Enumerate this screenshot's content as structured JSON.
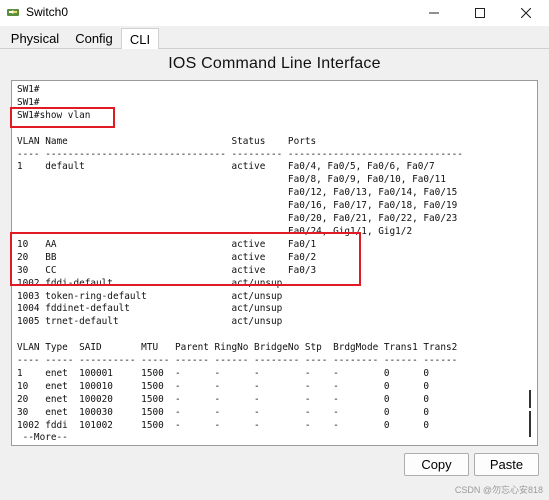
{
  "window": {
    "title": "Switch0"
  },
  "tabs": [
    {
      "label": "Physical"
    },
    {
      "label": "Config"
    },
    {
      "label": "CLI"
    }
  ],
  "heading": "IOS Command Line Interface",
  "terminal": {
    "lines": [
      "SW1#",
      "SW1#",
      "SW1#show vlan",
      "",
      "VLAN Name                             Status    Ports",
      "---- -------------------------------- --------- -------------------------------",
      "1    default                          active    Fa0/4, Fa0/5, Fa0/6, Fa0/7",
      "                                                Fa0/8, Fa0/9, Fa0/10, Fa0/11",
      "                                                Fa0/12, Fa0/13, Fa0/14, Fa0/15",
      "                                                Fa0/16, Fa0/17, Fa0/18, Fa0/19",
      "                                                Fa0/20, Fa0/21, Fa0/22, Fa0/23",
      "                                                Fa0/24, Gig1/1, Gig1/2",
      "10   AA                               active    Fa0/1",
      "20   BB                               active    Fa0/2",
      "30   CC                               active    Fa0/3",
      "1002 fddi-default                     act/unsup",
      "1003 token-ring-default               act/unsup",
      "1004 fddinet-default                  act/unsup",
      "1005 trnet-default                    act/unsup",
      "",
      "VLAN Type  SAID       MTU   Parent RingNo BridgeNo Stp  BrdgMode Trans1 Trans2",
      "---- ----- ---------- ----- ------ ------ -------- ---- -------- ------ ------",
      "1    enet  100001     1500  -      -      -        -    -        0      0",
      "10   enet  100010     1500  -      -      -        -    -        0      0",
      "20   enet  100020     1500  -      -      -        -    -        0      0",
      "30   enet  100030     1500  -      -      -        -    -        0      0",
      "1002 fddi  101002     1500  -      -      -        -    -        0      0",
      " --More--"
    ]
  },
  "buttons": {
    "copy": "Copy",
    "paste": "Paste"
  },
  "watermark": "CSDN @勿忘心安818",
  "icons": {
    "app": "switch-icon",
    "minimize": "minimize-icon",
    "maximize": "maximize-icon",
    "close": "close-icon"
  },
  "colors": {
    "highlight": "#e01b24",
    "terminal_bg": "#ffffff",
    "window_bg": "#f0f0f0"
  }
}
